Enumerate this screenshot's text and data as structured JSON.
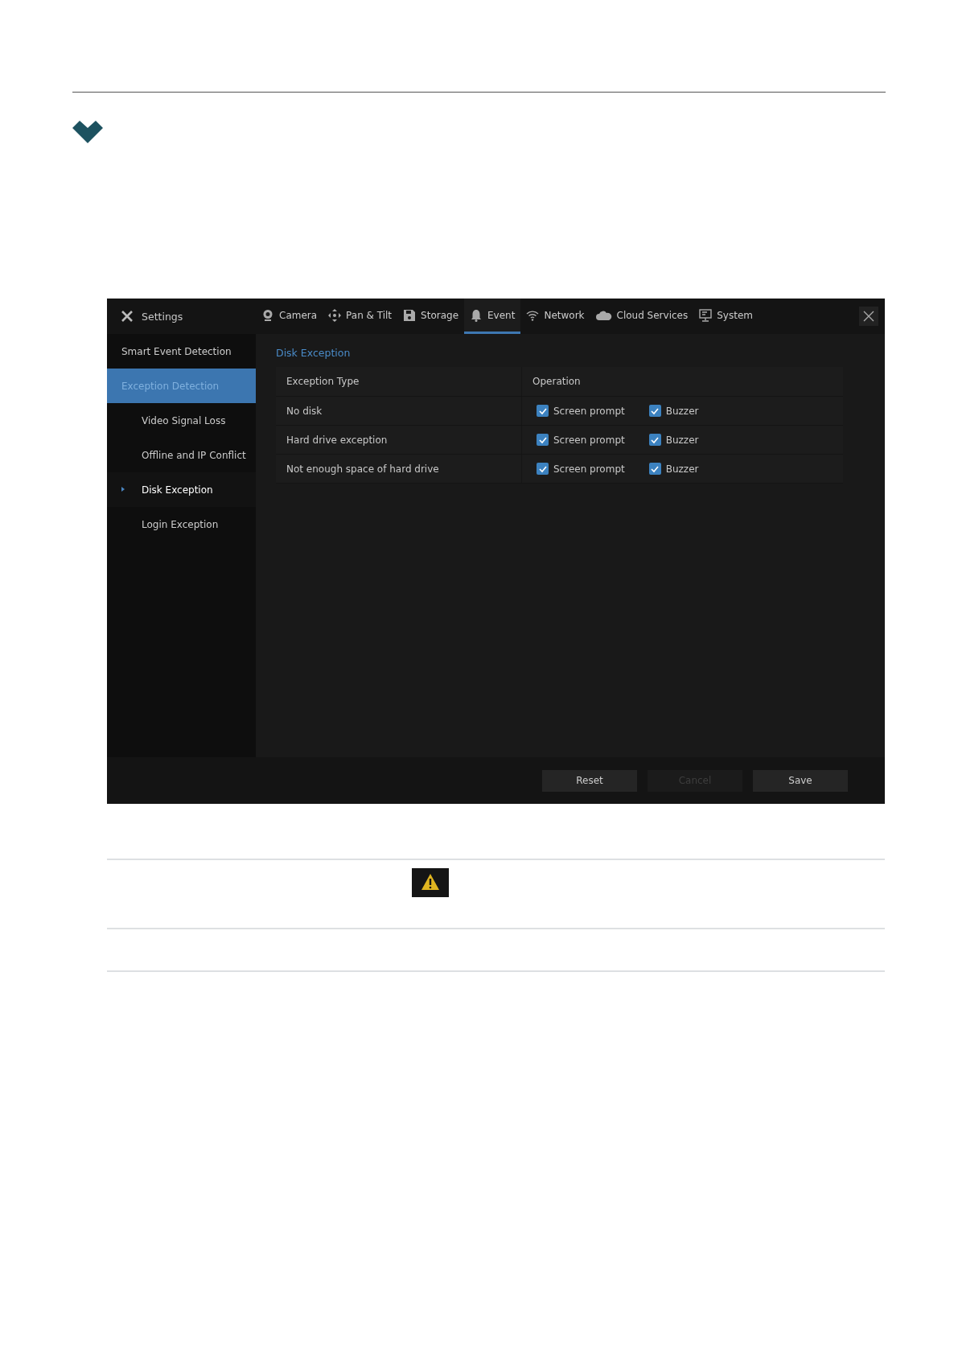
{
  "window": {
    "title": "Settings"
  },
  "tabs": [
    {
      "label": "Camera",
      "selected": false
    },
    {
      "label": "Pan & Tilt",
      "selected": false
    },
    {
      "label": "Storage",
      "selected": false
    },
    {
      "label": "Event",
      "selected": true
    },
    {
      "label": "Network",
      "selected": false
    },
    {
      "label": "Cloud Services",
      "selected": false
    },
    {
      "label": "System",
      "selected": false
    }
  ],
  "sidebar": {
    "items": [
      {
        "label": "Smart Event Detection",
        "selected": false
      },
      {
        "label": "Exception Detection",
        "selected": true,
        "children": [
          {
            "label": "Video Signal Loss",
            "selected": false
          },
          {
            "label": "Offline and IP Conflict",
            "selected": false
          },
          {
            "label": "Disk Exception",
            "selected": true
          },
          {
            "label": "Login Exception",
            "selected": false
          }
        ]
      }
    ]
  },
  "section_title": "Disk Exception",
  "table": {
    "columns": [
      "Exception Type",
      "Operation"
    ],
    "rows": [
      {
        "type": "No disk",
        "options": [
          {
            "label": "Screen prompt",
            "checked": true
          },
          {
            "label": "Buzzer",
            "checked": true
          }
        ]
      },
      {
        "type": "Hard drive exception",
        "options": [
          {
            "label": "Screen prompt",
            "checked": true
          },
          {
            "label": "Buzzer",
            "checked": true
          }
        ]
      },
      {
        "type": "Not enough space of hard drive",
        "options": [
          {
            "label": "Screen prompt",
            "checked": true
          },
          {
            "label": "Buzzer",
            "checked": true
          }
        ]
      }
    ]
  },
  "buttons": [
    {
      "label": "Reset",
      "disabled": false
    },
    {
      "label": "Cancel",
      "disabled": true
    },
    {
      "label": "Save",
      "disabled": false
    }
  ]
}
